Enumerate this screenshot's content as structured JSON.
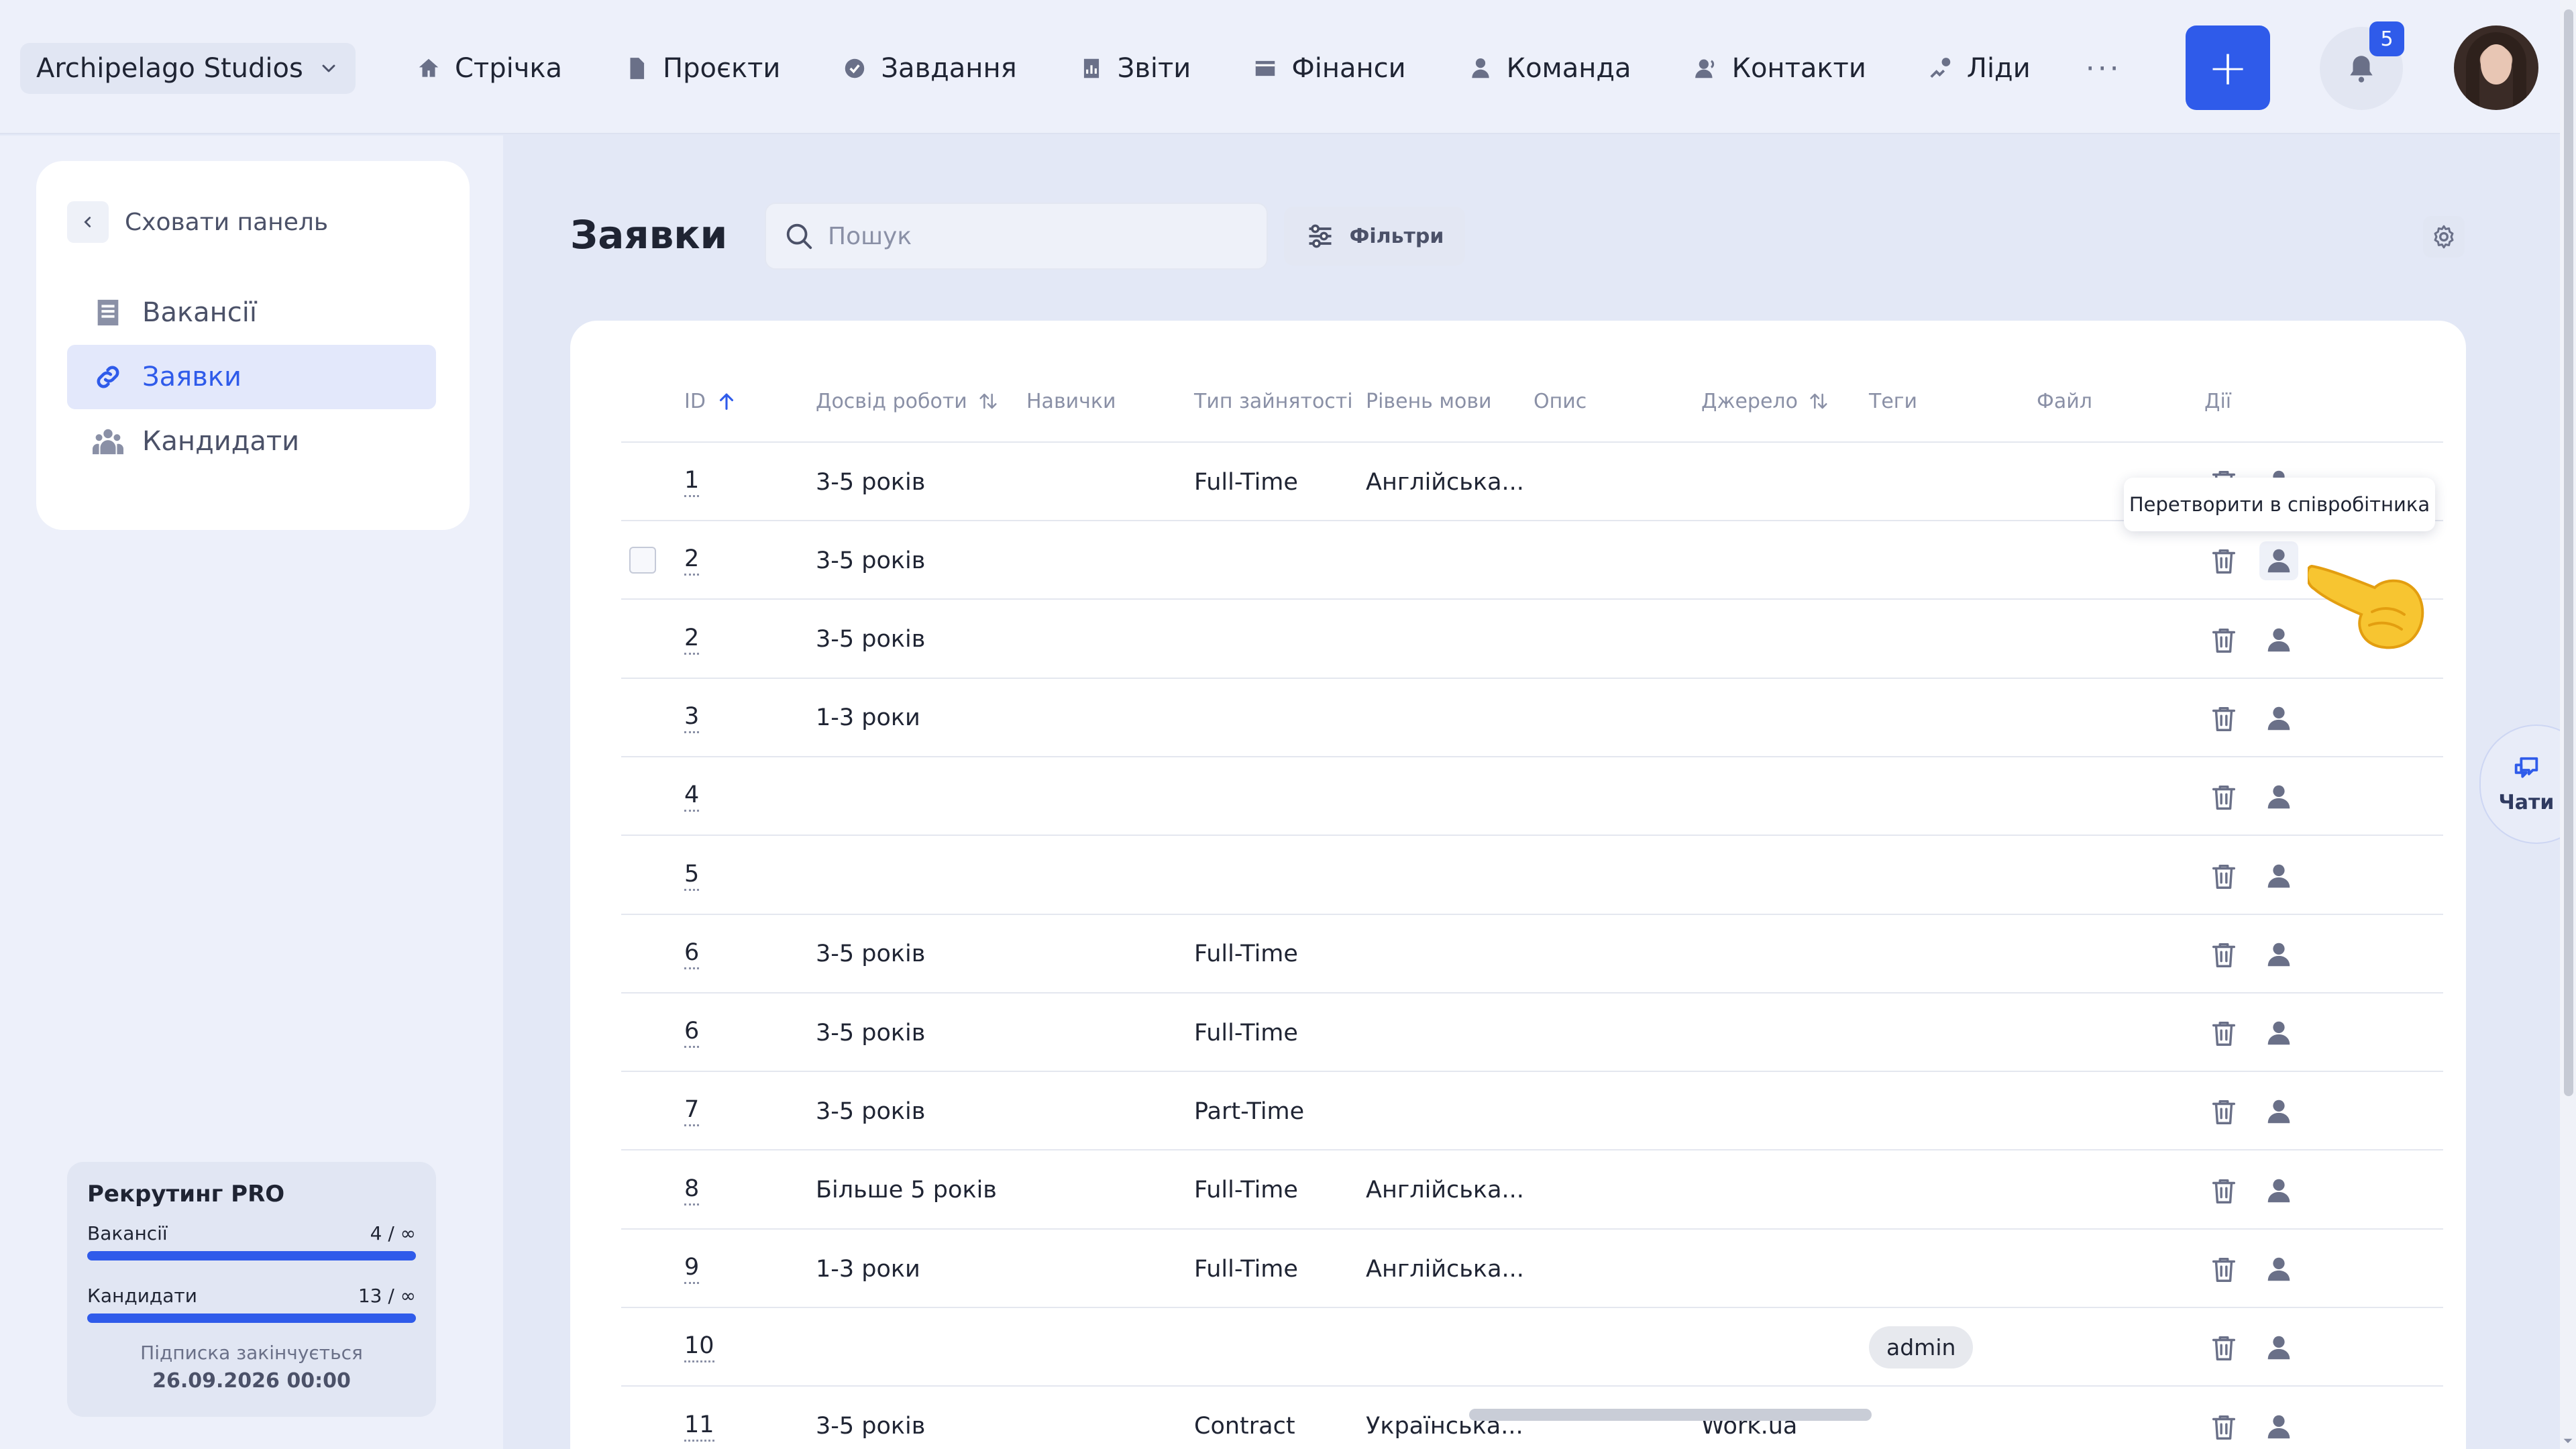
{
  "company": {
    "name": "Archipelago Studios"
  },
  "nav": [
    {
      "label": "Стрічка",
      "icon": "home-icon"
    },
    {
      "label": "Проєкти",
      "icon": "file-icon"
    },
    {
      "label": "Завдання",
      "icon": "check-circle-icon"
    },
    {
      "label": "Звіти",
      "icon": "report-icon"
    },
    {
      "label": "Фінанси",
      "icon": "wallet-icon"
    },
    {
      "label": "Команда",
      "icon": "user-icon"
    },
    {
      "label": "Контакти",
      "icon": "contacts-icon"
    },
    {
      "label": "Ліди",
      "icon": "leads-icon"
    }
  ],
  "nav_more": "···",
  "add_button": "+",
  "notifications": {
    "count": "5"
  },
  "sidebar": {
    "hide_label": "Сховати панель",
    "items": [
      {
        "label": "Вакансії",
        "icon": "document-icon",
        "active": false
      },
      {
        "label": "Заявки",
        "icon": "link-icon",
        "active": true
      },
      {
        "label": "Кандидати",
        "icon": "people-icon",
        "active": false
      }
    ],
    "plan": {
      "title": "Рекрутинг PRO",
      "vacancies_label": "Вакансії",
      "vacancies_value": "4 / ∞",
      "candidates_label": "Кандидати",
      "candidates_value": "13 / ∞",
      "expires_label": "Підписка закінчується",
      "expires_date": "26.09.2026 00:00"
    }
  },
  "page": {
    "title": "Заявки",
    "search_placeholder": "Пошук",
    "filters_label": "Фільтри"
  },
  "table": {
    "columns": [
      "ID",
      "Досвід роботи",
      "Навички",
      "Тип зайнятості",
      "Рівень мови",
      "Опис",
      "Джерело",
      "Теги",
      "Файл",
      "Дії"
    ],
    "rows": [
      {
        "id": "1",
        "experience": "3-5 років",
        "employment": "Full-Time",
        "language": "Англійська...",
        "source": "",
        "tag": ""
      },
      {
        "id": "2",
        "experience": "3-5 років",
        "employment": "",
        "language": "",
        "source": "",
        "tag": ""
      },
      {
        "id": "2",
        "experience": "3-5 років",
        "employment": "",
        "language": "",
        "source": "",
        "tag": ""
      },
      {
        "id": "3",
        "experience": "1-3 роки",
        "employment": "",
        "language": "",
        "source": "",
        "tag": ""
      },
      {
        "id": "4",
        "experience": "",
        "employment": "",
        "language": "",
        "source": "",
        "tag": ""
      },
      {
        "id": "5",
        "experience": "",
        "employment": "",
        "language": "",
        "source": "",
        "tag": ""
      },
      {
        "id": "6",
        "experience": "3-5 років",
        "employment": "Full-Time",
        "language": "",
        "source": "",
        "tag": ""
      },
      {
        "id": "6",
        "experience": "3-5 років",
        "employment": "Full-Time",
        "language": "",
        "source": "",
        "tag": ""
      },
      {
        "id": "7",
        "experience": "3-5 років",
        "employment": "Part-Time",
        "language": "",
        "source": "",
        "tag": ""
      },
      {
        "id": "8",
        "experience": "Більше 5 років",
        "employment": "Full-Time",
        "language": "Англійська...",
        "source": "",
        "tag": ""
      },
      {
        "id": "9",
        "experience": "1-3 роки",
        "employment": "Full-Time",
        "language": "Англійська...",
        "source": "",
        "tag": ""
      },
      {
        "id": "10",
        "experience": "",
        "employment": "",
        "language": "",
        "source": "",
        "tag": "admin"
      },
      {
        "id": "11",
        "experience": "3-5 років",
        "employment": "Contract",
        "language": "Українська...",
        "source": "Work.ua",
        "tag": ""
      }
    ]
  },
  "tooltip": "Перетворити в співробітника",
  "chats_label": "Чати",
  "colors": {
    "accent": "#2f5bea",
    "background": "#e3e8f6",
    "card": "#ffffff"
  }
}
